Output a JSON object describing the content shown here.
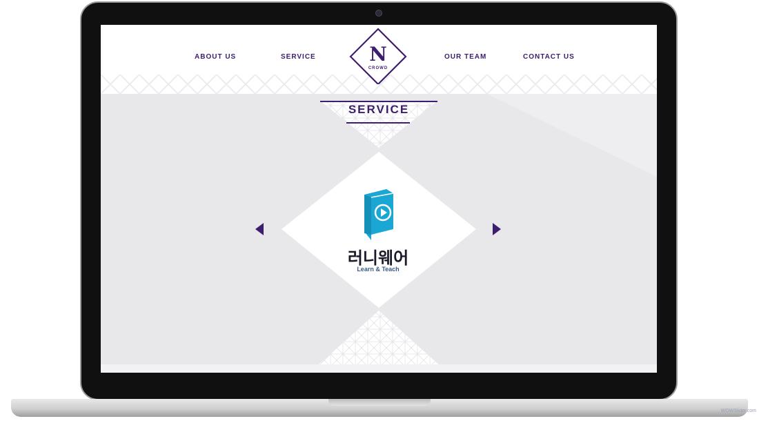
{
  "nav": {
    "items": [
      {
        "label": "ABOUT US"
      },
      {
        "label": "SERVICE"
      },
      {
        "label": "OUR TEAM"
      },
      {
        "label": "CONTACT US"
      }
    ],
    "logo_letter": "N",
    "logo_word": "CROWD"
  },
  "section": {
    "title": "SERVICE"
  },
  "slide": {
    "icon": "book-play-icon",
    "title": "러니웨어",
    "subtitle": "Learn & Teach"
  },
  "footer": {
    "watermark": "WOWSlider.com"
  },
  "colors": {
    "brand": "#3c1d6e",
    "icon_blue": "#1aa7d4",
    "screen_bg": "#e8e8ea",
    "subtitle": "#3c5a86"
  }
}
